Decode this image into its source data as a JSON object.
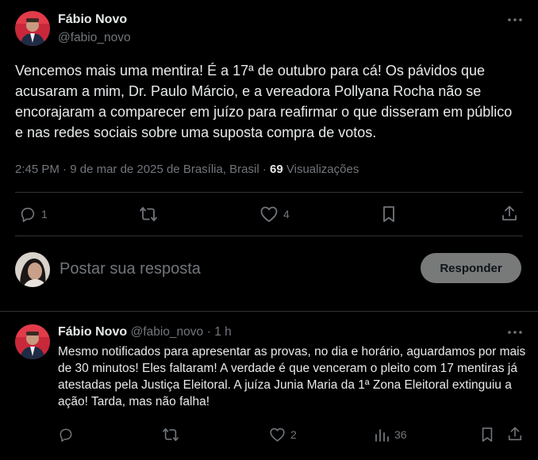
{
  "post": {
    "author_name": "Fábio Novo",
    "author_handle": "@fabio_novo",
    "text": "Vencemos mais uma mentira! É a 17ª de outubro para cá! Os pávidos que acusaram a mim, Dr. Paulo Márcio, e a vereadora Pollyana Rocha não se encorajaram a comparecer em juízo para reafirmar o que disseram em público e nas redes sociais sobre uma suposta compra de votos.",
    "time": "2:45 PM",
    "date": "9 de mar de 2025 de Brasília, Brasil",
    "separator": "·",
    "views_count": "69",
    "views_label": "Visualizações",
    "actions": {
      "reply_count": "1",
      "repost_count": "",
      "like_count": "4"
    },
    "icons": [
      "more-icon",
      "reply-icon",
      "repost-icon",
      "like-icon",
      "bookmark-icon",
      "share-icon"
    ]
  },
  "composer": {
    "placeholder": "Postar sua resposta",
    "button_label": "Responder",
    "button_color": "#787a7a"
  },
  "reply": {
    "author_name": "Fábio Novo",
    "author_handle": "@fabio_novo",
    "separator": "·",
    "time": "1 h",
    "text": "Mesmo notificados para apresentar as provas, no dia e horário, aguardamos por mais de 30 minutos! Eles faltaram! A verdade é que venceram o pleito com 17 mentiras já atestadas pela Justiça Eleitoral. A juíza Junia Maria da 1ª Zona Eleitoral extinguiu a ação! Tarda, mas não falha!",
    "actions": {
      "reply_count": "",
      "repost_count": "",
      "like_count": "2",
      "views_count": "36"
    }
  },
  "colors": {
    "background": "#000000",
    "text": "#e7e9ea",
    "secondary": "#71767b",
    "divider": "#2f3336"
  }
}
